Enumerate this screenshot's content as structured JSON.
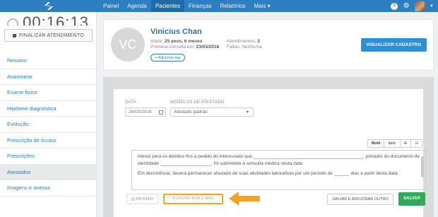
{
  "topbar": {
    "nav": [
      "Painel",
      "Agenda",
      "Pacientes",
      "Finanças",
      "Relatórios",
      "Mais ▾"
    ],
    "active": "Pacientes",
    "help_icon": "question-circle-icon",
    "settings_icon": "gear-icon",
    "accent": "#2d7fc1"
  },
  "sidebar": {
    "timer": "00:16:13",
    "finalize_label": "FINALIZAR ATENDIMENTO",
    "items": [
      {
        "label": "Resumo"
      },
      {
        "label": "Anamnese"
      },
      {
        "label": "Exame físico"
      },
      {
        "label": "Hipótese diagnóstica"
      },
      {
        "label": "Evolução"
      },
      {
        "label": "Prescrição de óculos"
      },
      {
        "label": "Prescrições"
      },
      {
        "label": "Atestados"
      },
      {
        "label": "Imagens e anexos"
      }
    ],
    "active": "Atestados"
  },
  "patient": {
    "initials": "VC",
    "name": "Vinicius Chan",
    "age_label": "Idade:",
    "age": "25 anos, 6 meses",
    "first_label": "Primeira consulta em:",
    "first": "23/03/2016",
    "visits_label": "Atendimentos:",
    "visits": "2",
    "missed_label": "Faltas:",
    "missed": "Nenhuma",
    "add_tag": "+ Adicionar tag",
    "view_button": "VISUALIZAR CADASTRO"
  },
  "form": {
    "date_label": "DATA",
    "date_value": "24/03/2016",
    "model_label": "MODELOS DE ATESTADO",
    "model_value": "Atestado padrão",
    "tools": [
      "Bold",
      "Italic"
    ],
    "text_p1": "Atesto para os devidos fins a pedido do interessado que ___________________________________________, portador do documento de identidade ____________________, foi submetido à consulta médica nesta data.",
    "text_p2": "Em decorrência, deverá permanecer afastado de suas atividades laborativas por um período de ______ dias a partir desta data.",
    "print_label": "IMPRIMIR",
    "email_label": "ENVIAR POR E-MAIL",
    "save_add_label": "SALVAR E ADICIONAR OUTRO",
    "save_label": "SALVAR",
    "highlight_color": "#f2a61f",
    "save_color": "#2eaa58"
  }
}
